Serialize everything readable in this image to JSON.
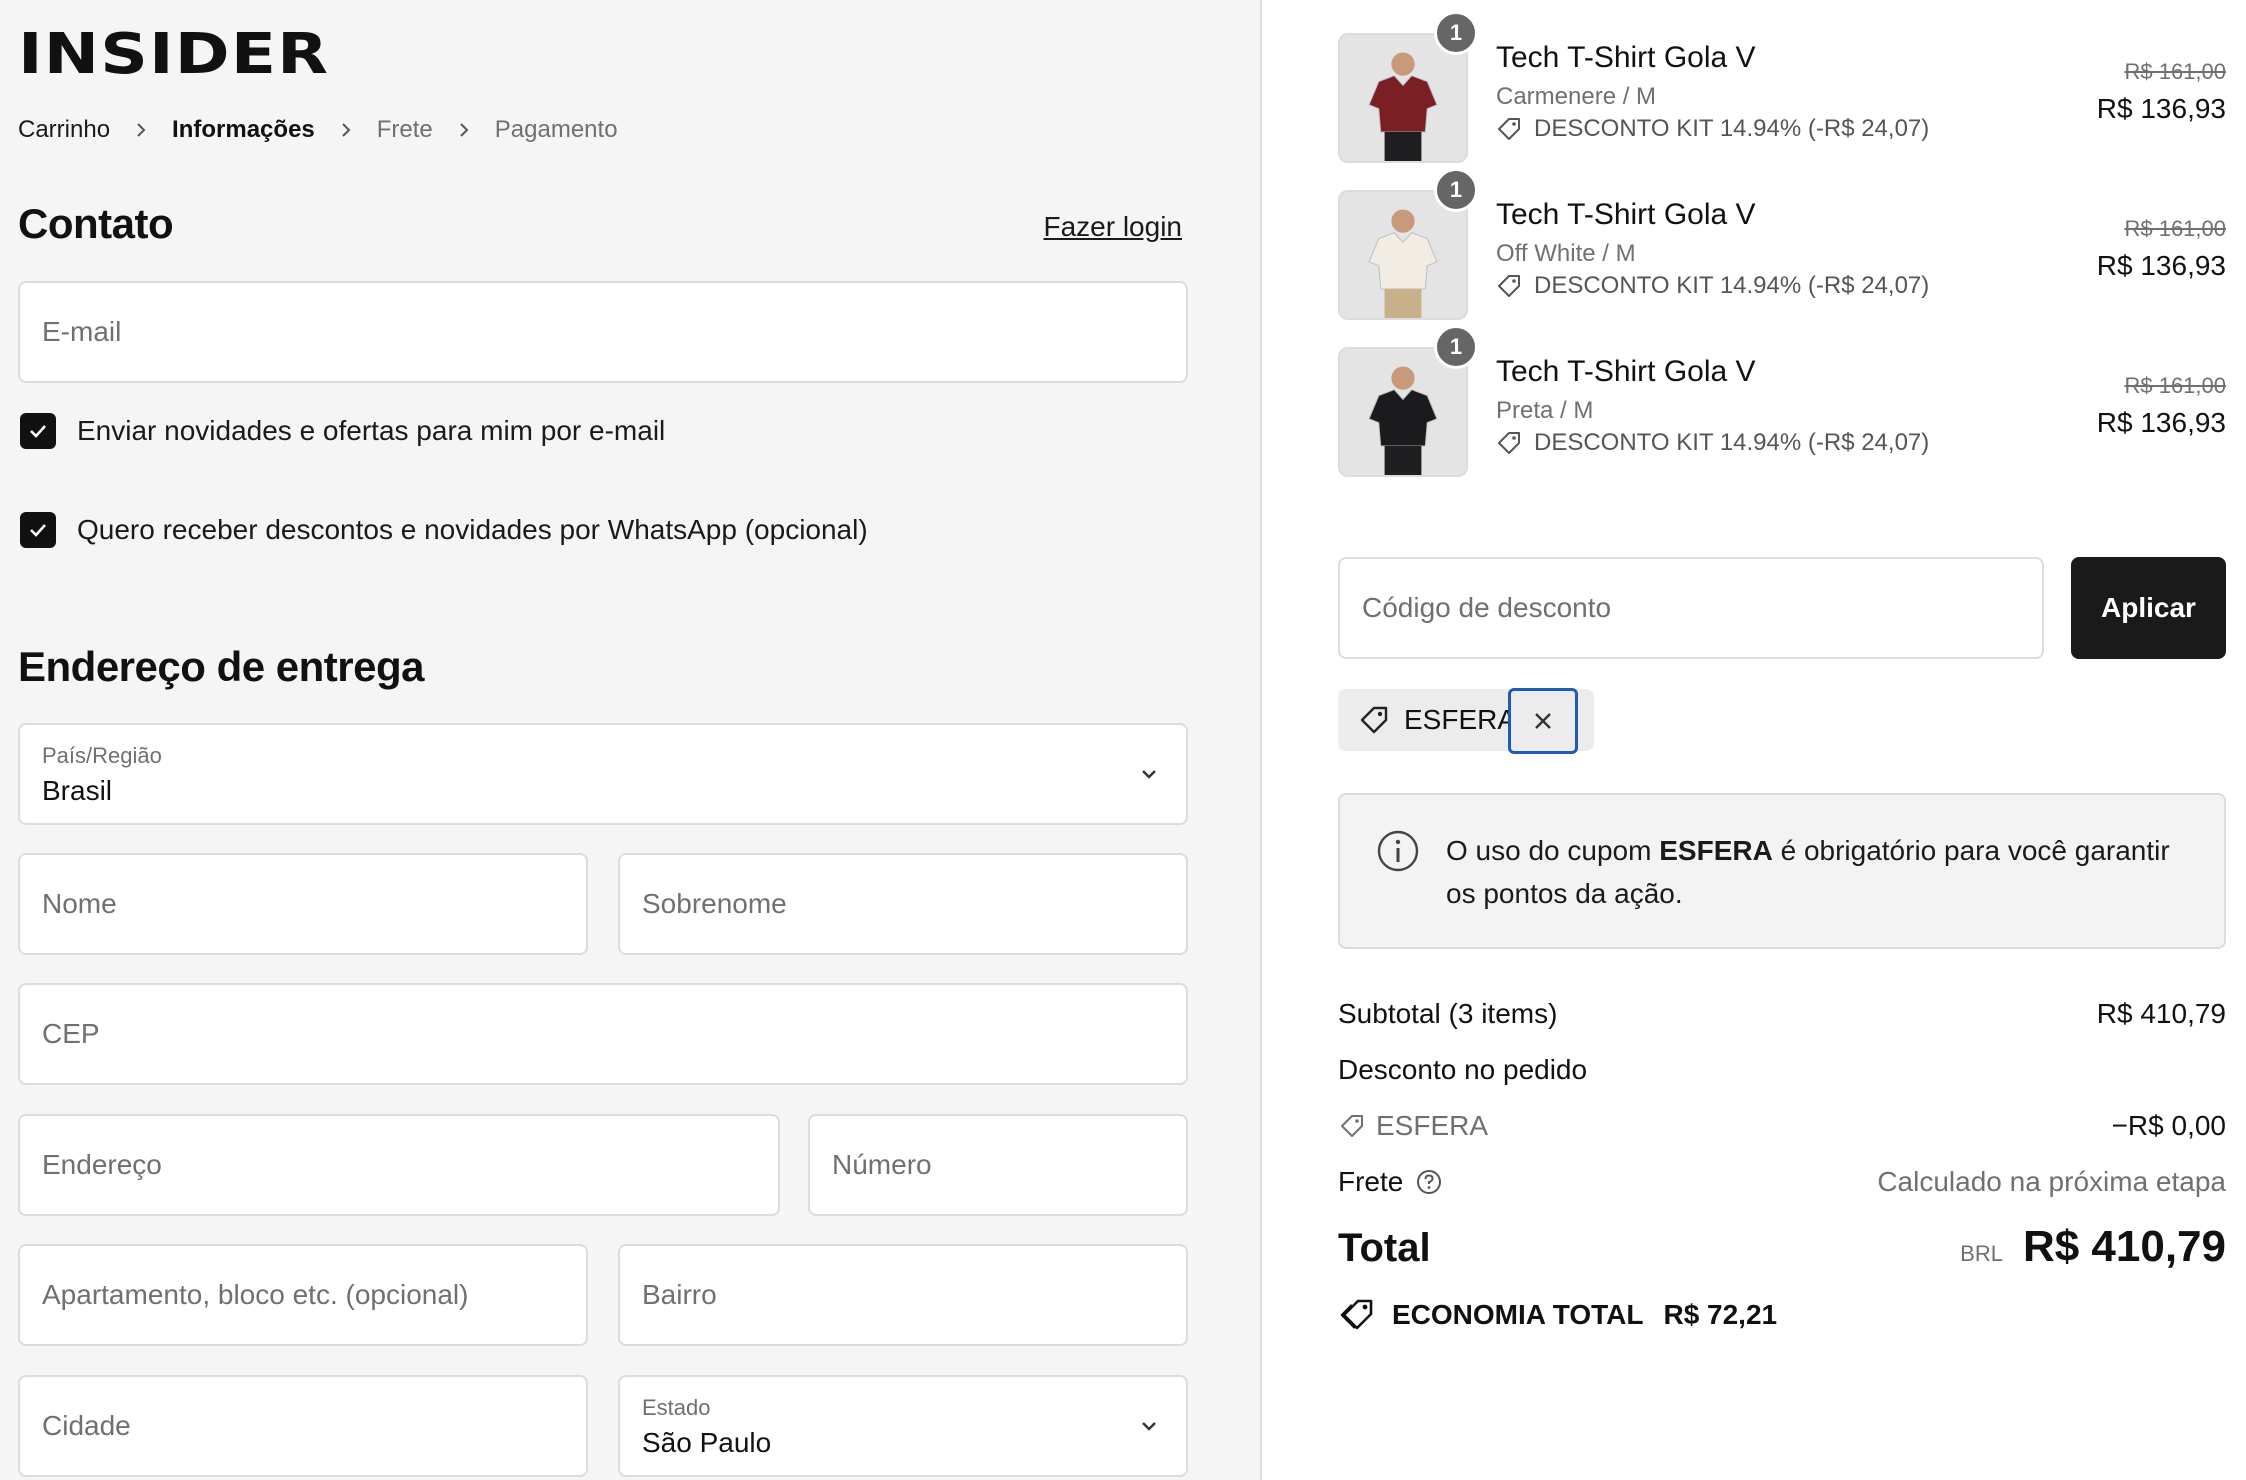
{
  "brand": {
    "logo_text": "INSIDER"
  },
  "breadcrumb": [
    {
      "label": "Carrinho"
    },
    {
      "label": "Informações"
    },
    {
      "label": "Frete"
    },
    {
      "label": "Pagamento"
    }
  ],
  "contact": {
    "title": "Contato",
    "login_link": "Fazer login",
    "email_placeholder": "E-mail",
    "newsletter_label": "Enviar novidades e ofertas para mim por e-mail",
    "newsletter_checked": true,
    "whatsapp_label": "Quero receber descontos e novidades por WhatsApp (opcional)",
    "whatsapp_checked": true
  },
  "shipping": {
    "title": "Endereço de entrega",
    "country_label": "País/Região",
    "country_value": "Brasil",
    "first_name_placeholder": "Nome",
    "last_name_placeholder": "Sobrenome",
    "cep_placeholder": "CEP",
    "address_placeholder": "Endereço",
    "number_placeholder": "Número",
    "apartment_placeholder": "Apartamento, bloco etc. (opcional)",
    "neighborhood_placeholder": "Bairro",
    "city_placeholder": "Cidade",
    "state_label": "Estado",
    "state_value": "São Paulo"
  },
  "cart": {
    "items": [
      {
        "qty": "1",
        "name": "Tech T-Shirt Gola V",
        "variant": "Carmenere / M",
        "discount": "DESCONTO KIT 14.94% (-R$ 24,07)",
        "old_price": "R$ 161,00",
        "price": "R$ 136,93",
        "shirt_color": "#7a1f24"
      },
      {
        "qty": "1",
        "name": "Tech T-Shirt Gola V",
        "variant": "Off White / M",
        "discount": "DESCONTO KIT 14.94% (-R$ 24,07)",
        "old_price": "R$ 161,00",
        "price": "R$ 136,93",
        "shirt_color": "#f1ede4"
      },
      {
        "qty": "1",
        "name": "Tech T-Shirt Gola V",
        "variant": "Preta / M",
        "discount": "DESCONTO KIT 14.94% (-R$ 24,07)",
        "old_price": "R$ 161,00",
        "price": "R$ 136,93",
        "shirt_color": "#1b1b1d"
      }
    ]
  },
  "discount": {
    "placeholder": "Código de desconto",
    "apply_label": "Aplicar",
    "applied_code": "ESFERA",
    "info_prefix": "O uso do cupom ",
    "info_code": "ESFERA",
    "info_suffix": " é obrigatório para você garantir os pontos da ação."
  },
  "summary": {
    "subtotal_label": "Subtotal (3 items)",
    "subtotal_value": "R$ 410,79",
    "order_discount_label": "Desconto no pedido",
    "coupon_label": "ESFERA",
    "coupon_value": "−R$ 0,00",
    "shipping_label": "Frete",
    "shipping_value": "Calculado na próxima etapa",
    "total_label": "Total",
    "currency": "BRL",
    "total_value": "R$ 410,79",
    "savings_label": "ECONOMIA TOTAL",
    "savings_value": "R$ 72,21"
  },
  "colors": {
    "accent_focus": "#1f5bb8",
    "button_dark": "#1a1a1a",
    "left_bg": "#f5f5f5"
  }
}
